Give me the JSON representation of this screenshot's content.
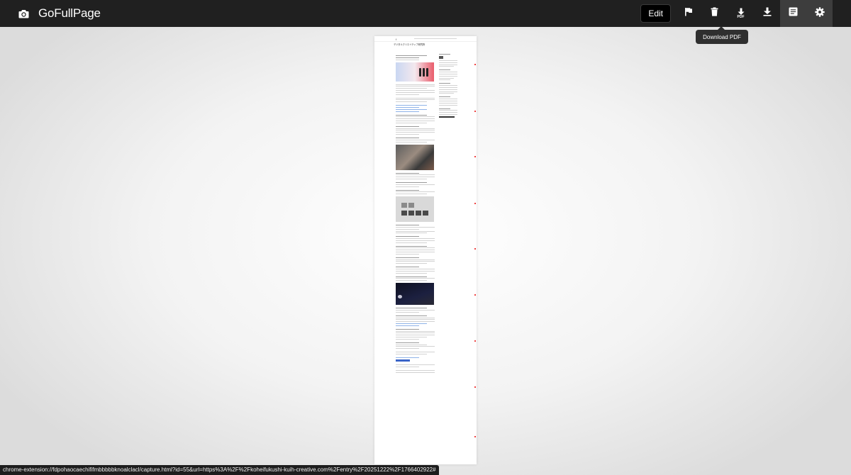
{
  "app": {
    "title": "GoFullPage",
    "logo_icon": "camera-icon"
  },
  "toolbar": {
    "edit_label": "Edit",
    "pdf_badge": "PDF",
    "icons": [
      "flag-icon",
      "trash-icon",
      "download-pdf-icon",
      "download-icon",
      "document-icon",
      "gear-icon"
    ],
    "active_tool": "document-icon"
  },
  "tooltip": {
    "text": "Download PDF"
  },
  "preview": {
    "page_title": "デジタルクリエイティブ研究所"
  },
  "status": {
    "url": "chrome-extension://fdpohaocaechififmbbbbbknoalclacl/capture.html?id=55&url=https%3A%2F%2Fkoheifukushi-kuih-creative.com%2Fentry%2F20251222%2F1766402922#"
  },
  "colors": {
    "topbar_bg": "#202020",
    "active_tool_bg": "#3d3d3d",
    "tooltip_bg": "#2f2f2f"
  }
}
